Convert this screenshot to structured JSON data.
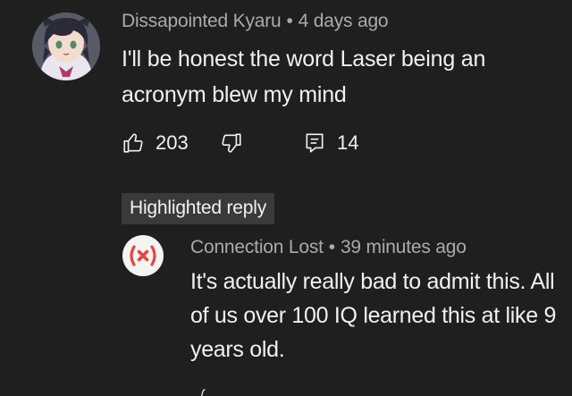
{
  "comment": {
    "author": "Dissapointed Kyaru",
    "separator": "•",
    "time": "4 days ago",
    "text": "I'll be honest the word Laser being an acronym blew my mind",
    "likes": "203",
    "replies": "14",
    "avatar_icon": "anime-cat-girl-avatar"
  },
  "highlight": {
    "label": "Highlighted reply"
  },
  "reply": {
    "author": "Connection Lost",
    "separator": "•",
    "time": "39 minutes ago",
    "text": "It's actually really bad to admit this. All of us over 100 IQ learned this at like 9 years old.",
    "avatar_icon": "connection-lost-icon",
    "accent_color": "#e8453c"
  },
  "icons": {
    "like": "thumbs-up-icon",
    "dislike": "thumbs-down-icon",
    "reply": "reply-comment-icon"
  }
}
